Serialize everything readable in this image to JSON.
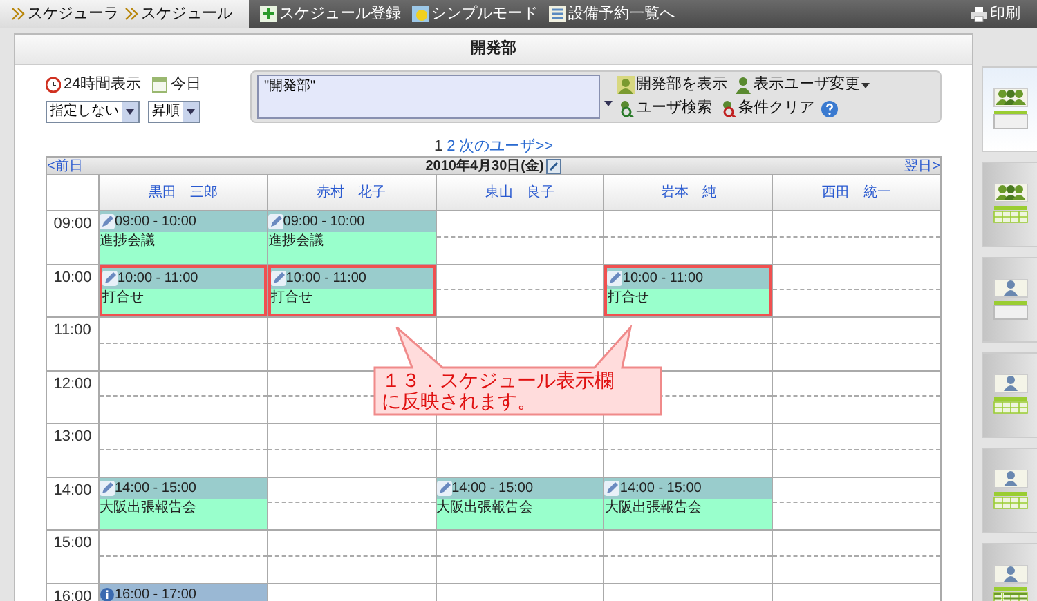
{
  "breadcrumbs": [
    "スケジューラ",
    "スケジュール"
  ],
  "toolbar": [
    "スケジュール登録",
    "シンプルモード",
    "設備予約一覧へ"
  ],
  "print": "印刷",
  "panel_title": "開発部",
  "options": {
    "hours24": "24時間表示",
    "today": "今日",
    "filter": "指定しない",
    "order": "昇順"
  },
  "search": {
    "value": "\"開発部\"",
    "buttons": [
      {
        "label": "開発部を表示",
        "kind": "group"
      },
      {
        "label": "表示ユーザ変更",
        "kind": "menu"
      },
      {
        "label": "ユーザ検索",
        "kind": "search"
      },
      {
        "label": "条件クリア",
        "kind": "clear"
      }
    ]
  },
  "pagination": [
    {
      "label": "1",
      "selected": true
    },
    {
      "label": "2",
      "selected": false
    },
    {
      "label": "次のユーザ>>",
      "selected": false
    }
  ],
  "nav": {
    "prev": "<前日",
    "date": "2010年4月30日(金)",
    "next": "翌日>"
  },
  "users": [
    "黒田　三郎",
    "赤村　花子",
    "東山　良子",
    "岩本　純",
    "西田　統一"
  ],
  "hours": [
    {
      "label": "09:00",
      "cells": [
        {
          "kind": "meeting",
          "time": "09:00 - 10:00",
          "title": "進捗会議",
          "highlighted": false
        },
        {
          "kind": "meeting",
          "time": "09:00 - 10:00",
          "title": "進捗会議",
          "highlighted": false
        },
        {
          "kind": "empty"
        },
        {
          "kind": "empty"
        },
        {
          "kind": "empty"
        }
      ]
    },
    {
      "label": "10:00",
      "cells": [
        {
          "kind": "meeting",
          "time": "10:00 - 11:00",
          "title": "打合せ",
          "highlighted": true
        },
        {
          "kind": "meeting",
          "time": "10:00 - 11:00",
          "title": "打合せ",
          "highlighted": true
        },
        {
          "kind": "empty"
        },
        {
          "kind": "meeting",
          "time": "10:00 - 11:00",
          "title": "打合せ",
          "highlighted": true
        },
        {
          "kind": "empty"
        }
      ]
    },
    {
      "label": "11:00",
      "cells": [
        {
          "kind": "empty"
        },
        {
          "kind": "empty"
        },
        {
          "kind": "empty"
        },
        {
          "kind": "empty"
        },
        {
          "kind": "empty"
        }
      ]
    },
    {
      "label": "12:00",
      "cells": [
        {
          "kind": "empty"
        },
        {
          "kind": "empty"
        },
        {
          "kind": "empty"
        },
        {
          "kind": "empty"
        },
        {
          "kind": "empty"
        }
      ]
    },
    {
      "label": "13:00",
      "cells": [
        {
          "kind": "empty"
        },
        {
          "kind": "empty"
        },
        {
          "kind": "empty"
        },
        {
          "kind": "empty"
        },
        {
          "kind": "empty"
        }
      ]
    },
    {
      "label": "14:00",
      "cells": [
        {
          "kind": "meeting",
          "time": "14:00 - 15:00",
          "title": "大阪出張報告会",
          "highlighted": false
        },
        {
          "kind": "empty"
        },
        {
          "kind": "meeting",
          "time": "14:00 - 15:00",
          "title": "大阪出張報告会",
          "highlighted": false
        },
        {
          "kind": "meeting",
          "time": "14:00 - 15:00",
          "title": "大阪出張報告会",
          "highlighted": false
        },
        {
          "kind": "empty"
        }
      ]
    },
    {
      "label": "15:00",
      "cells": [
        {
          "kind": "empty"
        },
        {
          "kind": "empty"
        },
        {
          "kind": "empty"
        },
        {
          "kind": "empty"
        },
        {
          "kind": "empty"
        }
      ]
    },
    {
      "label": "16:00",
      "cells": [
        {
          "kind": "info",
          "time": "16:00 - 17:00",
          "highlighted": false
        },
        {
          "kind": "empty"
        },
        {
          "kind": "empty"
        },
        {
          "kind": "empty"
        },
        {
          "kind": "empty"
        }
      ]
    }
  ],
  "view_tabs": [
    {
      "selected": true
    },
    {
      "selected": false
    },
    {
      "selected": false
    },
    {
      "selected": false
    },
    {
      "selected": false
    },
    {
      "selected": false
    }
  ],
  "callout": [
    "１３．スケジュール表示欄",
    "に反映されます。"
  ]
}
